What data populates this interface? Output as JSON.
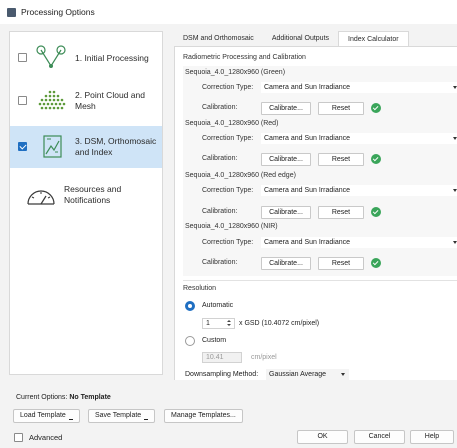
{
  "window": {
    "title": "Processing Options"
  },
  "nav": {
    "items": [
      {
        "label_lines": [
          "1. Initial Processing"
        ],
        "checked": false,
        "selected": false,
        "icon": "initial-processing-icon"
      },
      {
        "label_lines": [
          "2. Point Cloud and",
          "Mesh"
        ],
        "checked": false,
        "selected": false,
        "icon": "point-cloud-icon"
      },
      {
        "label_lines": [
          "3. DSM, Orthomosaic",
          "and Index"
        ],
        "checked": true,
        "selected": true,
        "icon": "dsm-icon"
      },
      {
        "label_lines": [
          "Resources and",
          "Notifications"
        ],
        "checked": null,
        "selected": false,
        "icon": "gauge-icon"
      }
    ]
  },
  "tabs": [
    {
      "label": "DSM and Orthomosaic",
      "active": false
    },
    {
      "label": "Additional Outputs",
      "active": false
    },
    {
      "label": "Index Calculator",
      "active": true
    }
  ],
  "calibration": {
    "title": "Radiometric Processing and Calibration",
    "correction_label": "Correction Type:",
    "calibration_label": "Calibration:",
    "calibrate_button": "Calibrate...",
    "reset_button": "Reset",
    "bands": [
      {
        "name": "Sequoia_4.0_1280x960 (Green)",
        "correction_type": "Camera and Sun Irradiance",
        "calibrated": true
      },
      {
        "name": "Sequoia_4.0_1280x960 (Red)",
        "correction_type": "Camera and Sun Irradiance",
        "calibrated": true
      },
      {
        "name": "Sequoia_4.0_1280x960 (Red edge)",
        "correction_type": "Camera and Sun Irradiance",
        "calibrated": true
      },
      {
        "name": "Sequoia_4.0_1280x960 (NIR)",
        "correction_type": "Camera and Sun Irradiance",
        "calibrated": true
      }
    ]
  },
  "resolution": {
    "title": "Resolution",
    "automatic_label": "Automatic",
    "automatic_selected": true,
    "gsd_value": "1",
    "gsd_text": "x GSD (10.4072 cm/pixel)",
    "custom_label": "Custom",
    "custom_value": "10.41",
    "custom_unit": "cm/pixel",
    "downsampling_label": "Downsampling Method:",
    "downsampling_value": "Gaussian Average"
  },
  "footer": {
    "current_options_label": "Current Options:",
    "current_options_value": "No Template",
    "load_template": "Load Template",
    "save_template": "Save Template",
    "manage_templates": "Manage Templates...",
    "advanced_label": "Advanced",
    "advanced_checked": false,
    "ok": "OK",
    "cancel": "Cancel",
    "help": "Help"
  },
  "colors": {
    "accent": "#1f6fc2",
    "selected_bg": "#cfe4f7",
    "ok_green": "#3aa55a"
  }
}
